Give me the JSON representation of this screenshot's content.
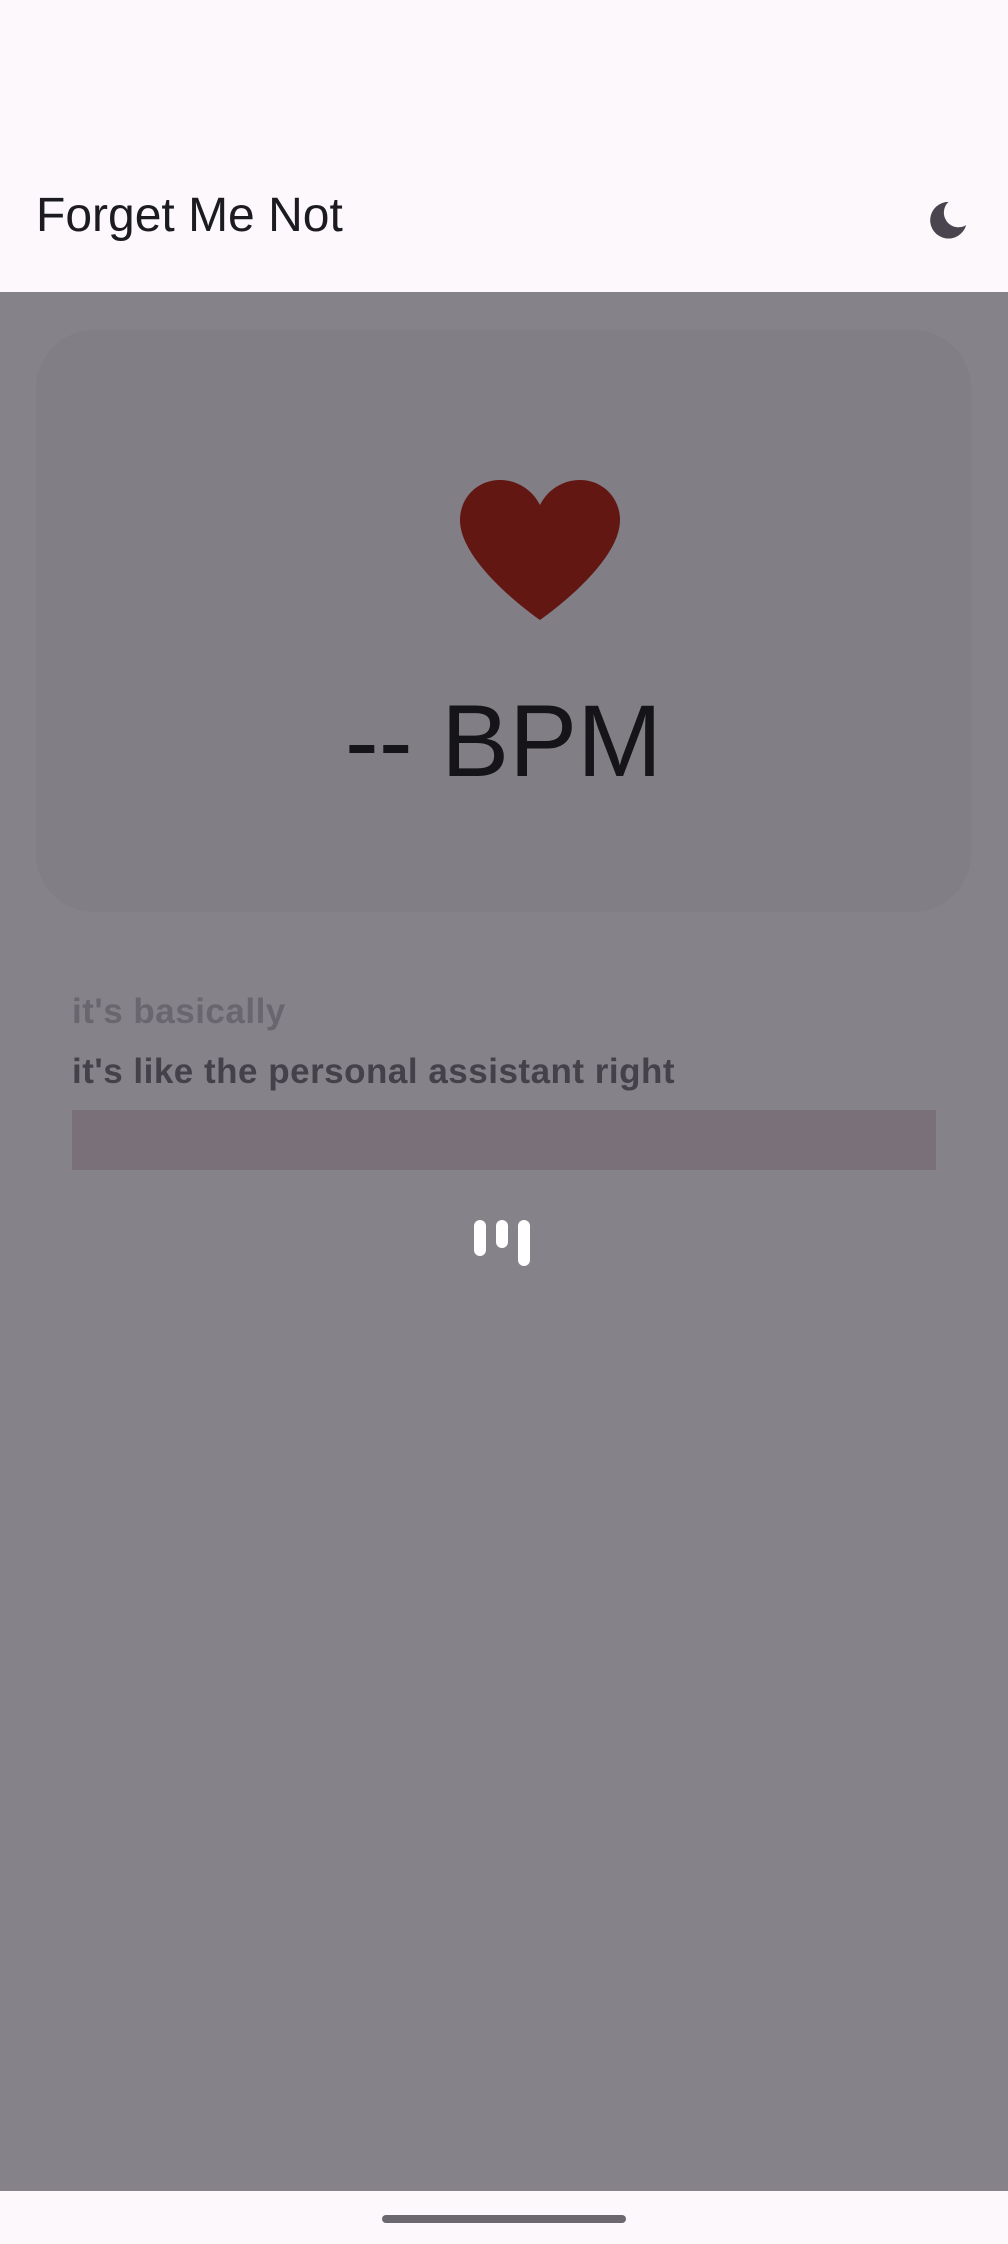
{
  "app_bar": {
    "title": "Forget Me Not",
    "theme_icon": "moon-icon"
  },
  "heart_rate": {
    "icon": "heart-icon",
    "display": "-- BPM",
    "heart_color": "#621713"
  },
  "transcript": {
    "partial_line": "it's basically",
    "main_line": "it's like the personal assistant right"
  },
  "recording_indicator": {
    "icon": "audio-bars-icon"
  },
  "colors": {
    "overlay": "#86828a",
    "card": "#827e86",
    "surface": "#fdf8fc"
  }
}
